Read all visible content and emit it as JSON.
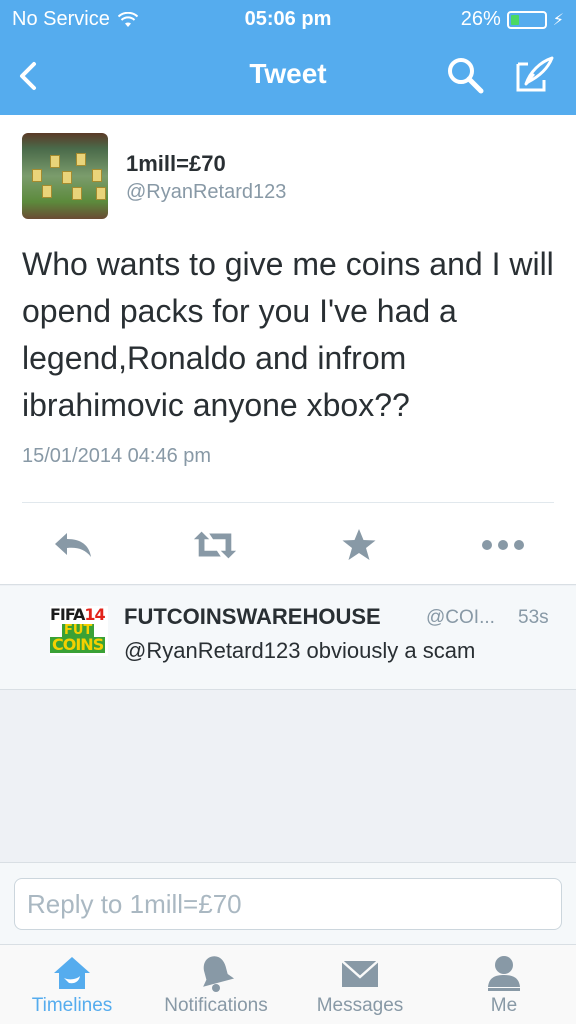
{
  "status_bar": {
    "carrier": "No Service",
    "time": "05:06 pm",
    "battery": "26%",
    "battery_level": 0.26
  },
  "nav": {
    "title": "Tweet",
    "back_icon": "chevron-left-icon",
    "search_icon": "search-icon",
    "compose_icon": "compose-icon"
  },
  "tweet": {
    "display_name": "1mill=£70",
    "handle": "@RyanRetard123",
    "text": "Who wants to give me coins and I will opend packs for you I've had a legend,Ronaldo and infrom ibrahimovic anyone xbox??",
    "timestamp": "15/01/2014 04:46 pm",
    "actions": [
      "reply-icon",
      "retweet-icon",
      "favorite-icon",
      "more-icon"
    ]
  },
  "reply": {
    "avatar_text": {
      "line1a": "FIFA",
      "line1b": "14",
      "line2": "FUT",
      "line3": "COINS"
    },
    "display_name": "FUTCOINSWAREHOUSE",
    "handle": "@COI...",
    "time": "53s",
    "text": "@RyanRetard123 obviously a scam"
  },
  "compose": {
    "placeholder": "Reply to 1mill=£70"
  },
  "tabs": [
    {
      "label": "Timelines",
      "icon": "home-icon",
      "active": true
    },
    {
      "label": "Notifications",
      "icon": "bell-icon",
      "active": false
    },
    {
      "label": "Messages",
      "icon": "envelope-icon",
      "active": false
    },
    {
      "label": "Me",
      "icon": "person-icon",
      "active": false
    }
  ],
  "colors": {
    "brand": "#55acee",
    "text": "#292f33",
    "muted": "#8899a6",
    "icon_gray": "#8899a6",
    "battery_green": "#4cd964"
  }
}
